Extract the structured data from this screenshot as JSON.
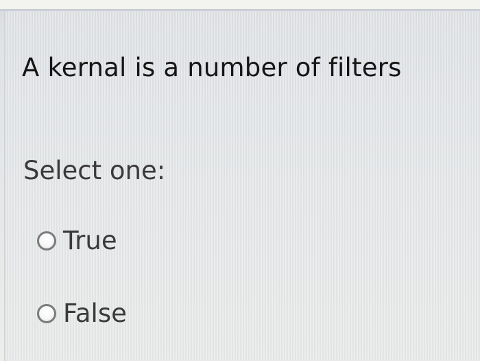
{
  "question": {
    "text": "A kernal is a number of filters"
  },
  "answer": {
    "prompt": "Select one:",
    "options": [
      {
        "label": "True",
        "icon": "radio-unselected-icon"
      },
      {
        "label": "False",
        "icon": "radio-unselected-icon"
      }
    ]
  }
}
